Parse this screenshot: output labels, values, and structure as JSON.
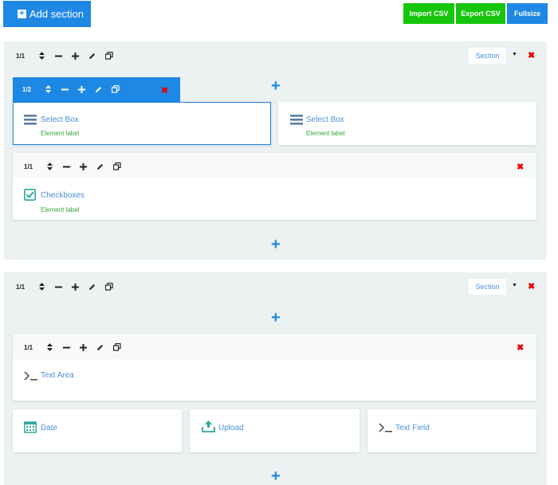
{
  "toolbar": {
    "add_section": "Add section",
    "import_csv": "Import CSV",
    "export_csv": "Export CSV",
    "fullsize": "Fullsize"
  },
  "colors": {
    "primary": "#1e88e5",
    "green": "#16c60c",
    "delete": "#e00000",
    "section_bg": "#ecf1f2",
    "label_green": "#3aa63a",
    "link_blue": "#4a90d9"
  },
  "sections": [
    {
      "ratio": "1/1",
      "type_label": "Section",
      "rows": [
        {
          "columns": [
            {
              "ratio": "1/2",
              "field": {
                "title": "Select Box",
                "label": "Element label",
                "icon": "list-icon"
              }
            },
            {
              "field": {
                "title": "Select Box",
                "label": "Element label",
                "icon": "list-icon"
              }
            }
          ]
        },
        {
          "ratio": "1/1",
          "field": {
            "title": "Checkboxes",
            "label": "Element label",
            "icon": "checkbox-icon"
          }
        }
      ]
    },
    {
      "ratio": "1/1",
      "type_label": "Section",
      "rows": [
        {
          "ratio": "1/1",
          "field": {
            "title": "Text Area",
            "icon": "terminal-icon"
          }
        },
        {
          "columns": [
            {
              "field": {
                "title": "Date",
                "icon": "calendar-icon"
              }
            },
            {
              "field": {
                "title": "Upload",
                "icon": "upload-icon"
              }
            },
            {
              "field": {
                "title": "Text Field",
                "icon": "terminal-icon"
              }
            }
          ]
        }
      ]
    }
  ]
}
